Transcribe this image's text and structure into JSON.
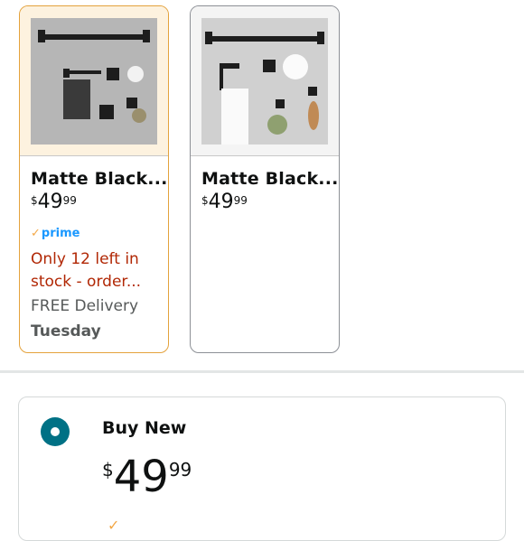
{
  "products": [
    {
      "title": "Matte Black...",
      "price": {
        "currency": "$",
        "whole": "49",
        "fraction": "99"
      },
      "prime": "prime",
      "stock": "Only 12 left in stock - order...",
      "delivery": "FREE Delivery",
      "delivery_day": "Tuesday",
      "selected": true,
      "image_icon": "bathroom-hardware-set-icon"
    },
    {
      "title": "Matte Black...",
      "price": {
        "currency": "$",
        "whole": "49",
        "fraction": "99"
      },
      "selected": false,
      "image_icon": "bathroom-hardware-set-icon"
    }
  ],
  "buy_box": {
    "label": "Buy New",
    "price": {
      "currency": "$",
      "whole": "49",
      "fraction": "99"
    }
  },
  "colors": {
    "selected_border": "#e4a23c",
    "price_red": "#b12704",
    "radio_teal": "#007185",
    "prime_blue": "#1a98ff"
  }
}
